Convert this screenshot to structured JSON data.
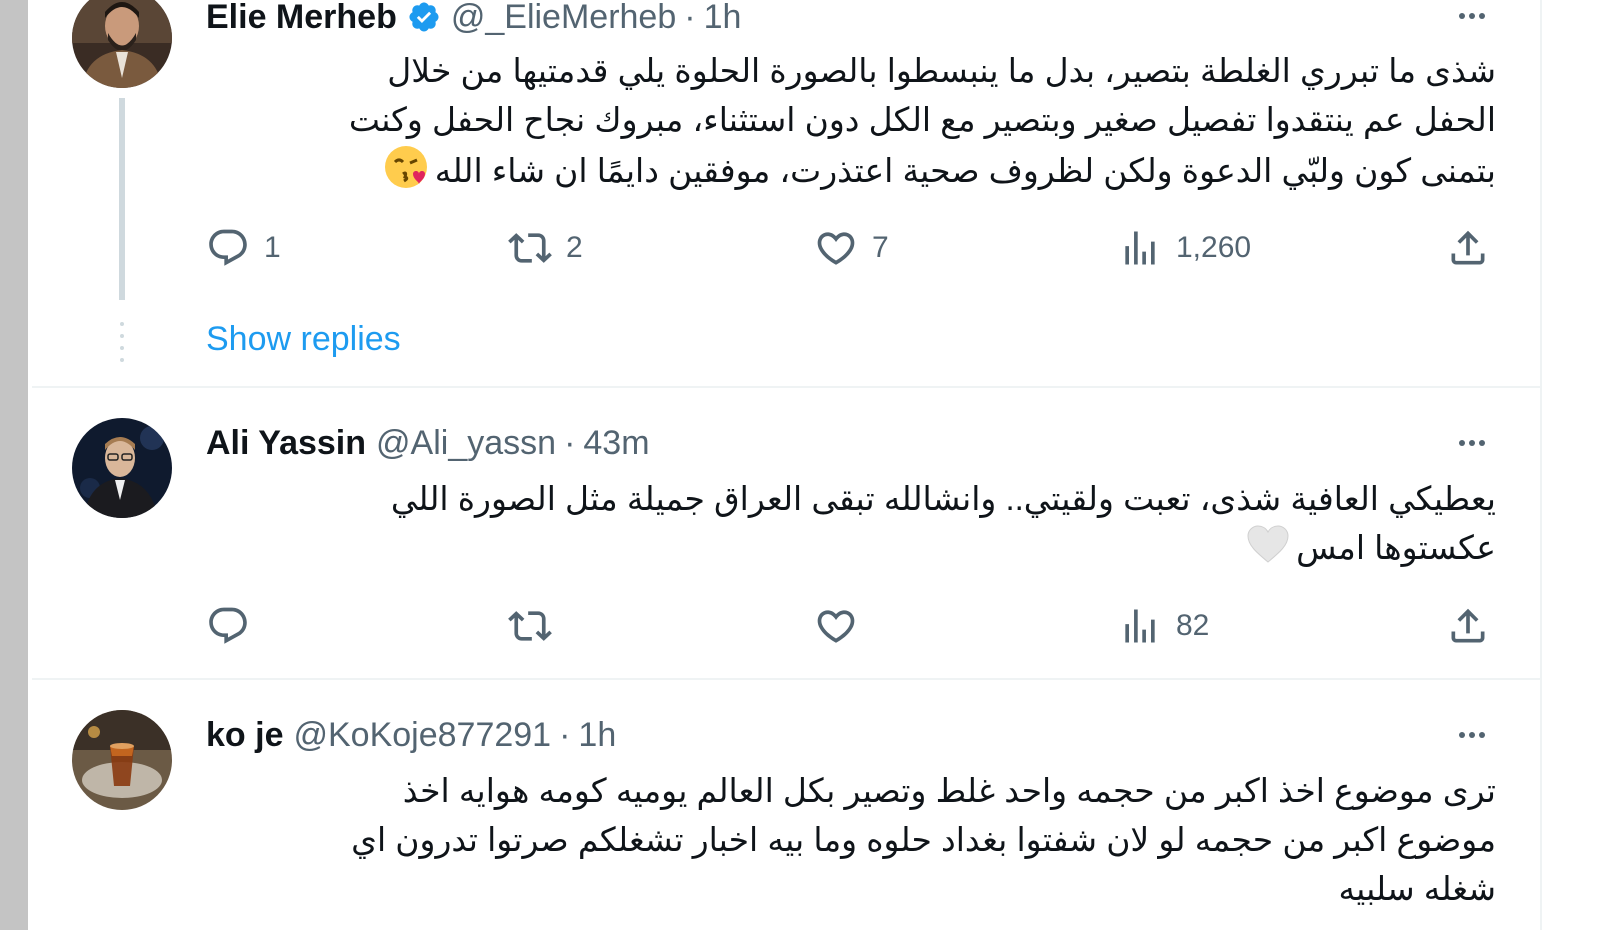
{
  "tweets": [
    {
      "name": "Elie Merheb",
      "verified": true,
      "handle": "@_ElieMerheb",
      "separator": "·",
      "time": "1h",
      "lines": [
        "شذى ما تبرري الغلطة بتصير، بدل ما ينبسطوا بالصورة الحلوة يلي قدمتيها من خلال",
        "الحفل عم ينتقدوا تفصيل صغير وبتصير مع الكل دون استثناء، مبروك نجاح الحفل وكنت",
        "بتمنى كون ولبّي الدعوة ولكن لظروف صحية اعتذرت، موفقين دايمًا ان شاء الله"
      ],
      "emoji": "face-blowing-kiss",
      "replies": "1",
      "reposts": "2",
      "likes": "7",
      "views": "1,260",
      "show_replies": "Show replies"
    },
    {
      "name": "Ali Yassin",
      "verified": false,
      "handle": "@Ali_yassn",
      "separator": "·",
      "time": "43m",
      "lines": [
        "يعطيكي العافية شذى، تعبت ولقيتي.. وانشالله تبقى العراق جميلة مثل الصورة اللي",
        "عكستوها امس"
      ],
      "emoji": "white-heart",
      "replies": "",
      "reposts": "",
      "likes": "",
      "views": "82"
    },
    {
      "name": "ko je",
      "verified": false,
      "handle": "@KoKoje877291",
      "separator": "·",
      "time": "1h",
      "lines": [
        "ترى موضوع اخذ اكبر من حجمه واحد غلط وتصير بكل العالم يوميه كومه هوايه اخذ",
        "موضوع اكبر من حجمه لو لان شفتوا بغداد حلوه وما بيه اخبار تشغلكم صرتوا تدرون اي",
        "شغله سلبيه"
      ]
    }
  ],
  "colors": {
    "text": "#0f1419",
    "secondary": "#536471",
    "accent": "#1d9bf0",
    "border": "#eff3f4"
  },
  "icons": [
    "verified-badge-icon",
    "more-icon",
    "reply-icon",
    "repost-icon",
    "like-icon",
    "views-icon",
    "share-icon"
  ]
}
